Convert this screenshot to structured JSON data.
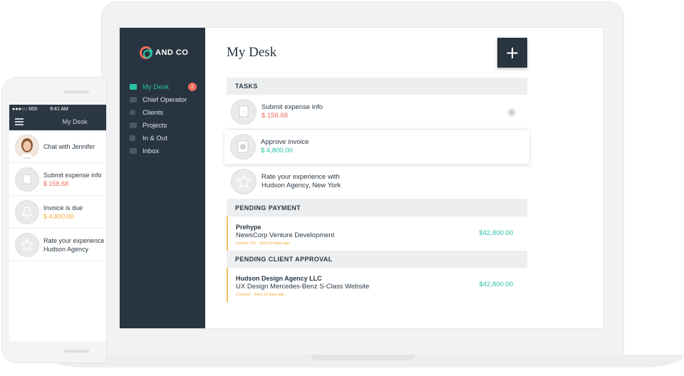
{
  "app": {
    "logo_text": "AND CO",
    "page_title": "My Desk",
    "add_button_label": "+"
  },
  "sidebar": {
    "items": [
      {
        "label": "My Desk",
        "badge": "2",
        "active": true,
        "icon": "desk-icon"
      },
      {
        "label": "Chief Operator",
        "icon": "chat-icon"
      },
      {
        "label": "Clients",
        "icon": "user-icon"
      },
      {
        "label": "Projects",
        "icon": "grid-icon"
      },
      {
        "label": "In & Out",
        "icon": "bar-chart-icon"
      },
      {
        "label": "Inbox",
        "icon": "inbox-icon"
      }
    ]
  },
  "tasks": {
    "header": "TASKS",
    "items": [
      {
        "title": "Submit expense info",
        "amount": "$ 158.68",
        "count": "9",
        "icon": "receipt-icon"
      },
      {
        "title": "Approve invoice",
        "amount": "$ 4,800.00",
        "icon": "invoice-icon"
      },
      {
        "title_line1": "Rate your experience with",
        "title_line2": "Hudson Agency, New York",
        "icon": "star-icon"
      }
    ]
  },
  "pending_payment": {
    "header": "PENDING PAYMENT",
    "items": [
      {
        "client": "Prehype",
        "project": "NewsCorp Venture Development",
        "meta": "Invoice #15 · Sent 10 days ago",
        "amount": "$42,800.00"
      }
    ]
  },
  "pending_approval": {
    "header": "PENDING CLIENT APPROVAL",
    "items": [
      {
        "client": "Hudson Design Agency LLC",
        "project": "UX Design Mercedes-Benz S-Class Website",
        "meta": "Contract · Sent 10 days ago",
        "amount": "$42,800.00"
      }
    ]
  },
  "phone": {
    "status_carrier": "●●●○○ MSt",
    "status_time": "9:41 AM",
    "header_title": "My Desk",
    "items": [
      {
        "text": "Chat with Jennifer",
        "icon": "avatar"
      },
      {
        "text": "Submit expense info",
        "amount": "$ 158.68",
        "icon": "receipt-icon"
      },
      {
        "text": "Invoice is due",
        "amount": "$ 4,800.00",
        "icon": "bell-icon"
      },
      {
        "text_line1": "Rate your experience",
        "text_line2": "Hudson Agency",
        "icon": "star-icon"
      }
    ]
  },
  "colors": {
    "sidebar_bg": "#283540",
    "accent_green": "#28c2a5",
    "accent_red": "#ee6b5b",
    "accent_orange": "#f3a939"
  }
}
